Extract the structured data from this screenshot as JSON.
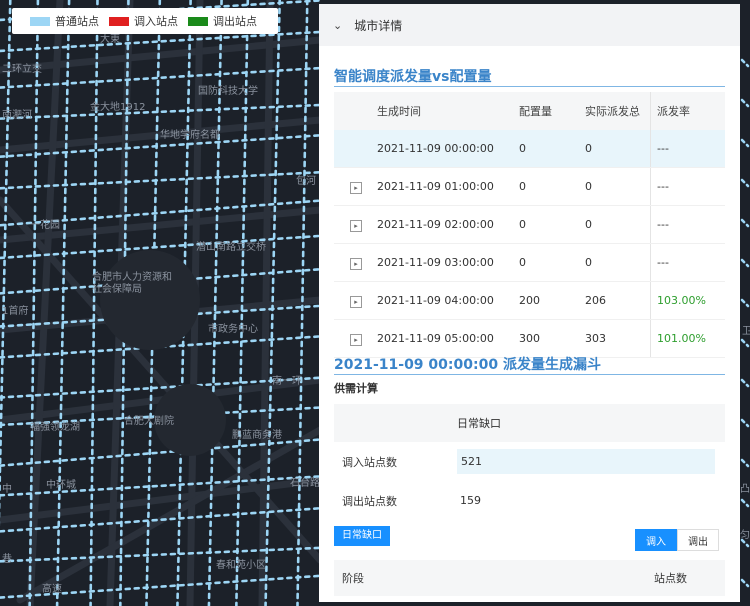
{
  "legend": [
    {
      "label": "普通站点",
      "color": "#9dd6f5"
    },
    {
      "label": "调入站点",
      "color": "#e02020"
    },
    {
      "label": "调出站点",
      "color": "#1a8a1a"
    }
  ],
  "map_labels": [
    "大東",
    "二环立交",
    "南淝河",
    "金大地1912",
    "国防科技大学",
    "华地学府名都",
    "包河",
    "一花园",
    "潜山南路立交桥",
    "合肥市人力资源和社会保障局",
    "1首府",
    "市政务中心",
    "南一环",
    "福强领龙湖",
    "合肥大剧院",
    "鹏蓝商务港",
    "中",
    "中环城",
    "石台路",
    "巷",
    "高速",
    "春和苑小区",
    "卫",
    "凸",
    "匀"
  ],
  "panel": {
    "title": "城市详情",
    "section1_title": "智能调度派发量vs配置量",
    "table1": {
      "headers": [
        "生成时间",
        "配置量",
        "实际派发总",
        "派发率"
      ],
      "rows": [
        {
          "time": "2021-11-09 00:00:00",
          "config": "0",
          "actual": "0",
          "rate": "---"
        },
        {
          "time": "2021-11-09 01:00:00",
          "config": "0",
          "actual": "0",
          "rate": "---"
        },
        {
          "time": "2021-11-09 02:00:00",
          "config": "0",
          "actual": "0",
          "rate": "---"
        },
        {
          "time": "2021-11-09 03:00:00",
          "config": "0",
          "actual": "0",
          "rate": "---"
        },
        {
          "time": "2021-11-09 04:00:00",
          "config": "200",
          "actual": "206",
          "rate": "103.00%"
        },
        {
          "time": "2021-11-09 05:00:00",
          "config": "300",
          "actual": "303",
          "rate": "101.00%"
        }
      ]
    },
    "section2_title": "2021-11-09 00:00:00 派发量生成漏斗",
    "supply_label": "供需计算",
    "table2": {
      "col_header": "日常缺口",
      "rows": [
        {
          "label": "调入站点数",
          "value": "521"
        },
        {
          "label": "调出站点数",
          "value": "159"
        }
      ]
    },
    "tag_button": "日常缺口",
    "toggle": [
      "调入",
      "调出"
    ],
    "table3": {
      "headers": [
        "阶段",
        "站点数"
      ]
    }
  }
}
